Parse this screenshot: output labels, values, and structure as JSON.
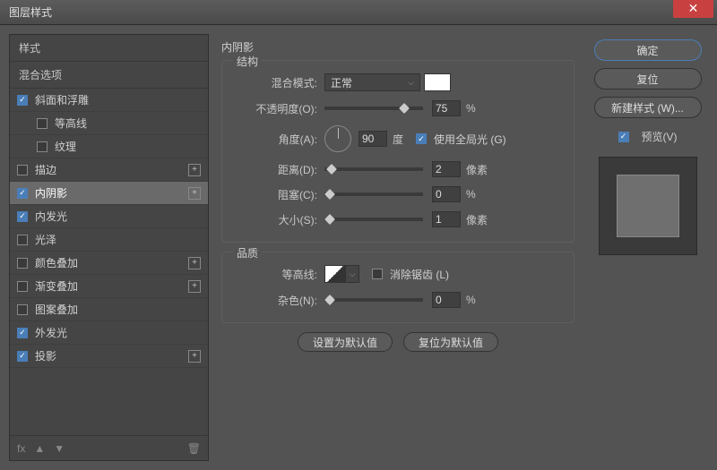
{
  "title": "图层样式",
  "sidebar": {
    "header_styles": "样式",
    "header_blend": "混合选项",
    "items": [
      {
        "label": "斜面和浮雕",
        "checked": true,
        "indent": false,
        "plus": false
      },
      {
        "label": "等高线",
        "checked": false,
        "indent": true,
        "plus": false
      },
      {
        "label": "纹理",
        "checked": false,
        "indent": true,
        "plus": false
      },
      {
        "label": "描边",
        "checked": false,
        "indent": false,
        "plus": true
      },
      {
        "label": "内阴影",
        "checked": true,
        "indent": false,
        "plus": true,
        "selected": true
      },
      {
        "label": "内发光",
        "checked": true,
        "indent": false,
        "plus": false
      },
      {
        "label": "光泽",
        "checked": false,
        "indent": false,
        "plus": false
      },
      {
        "label": "颜色叠加",
        "checked": false,
        "indent": false,
        "plus": true
      },
      {
        "label": "渐变叠加",
        "checked": false,
        "indent": false,
        "plus": true
      },
      {
        "label": "图案叠加",
        "checked": false,
        "indent": false,
        "plus": false
      },
      {
        "label": "外发光",
        "checked": true,
        "indent": false,
        "plus": false
      },
      {
        "label": "投影",
        "checked": true,
        "indent": false,
        "plus": true
      }
    ],
    "fx_label": "fx"
  },
  "center": {
    "title": "内阴影",
    "structure": {
      "legend": "结构",
      "blend_label": "混合模式:",
      "blend_value": "正常",
      "opacity_label": "不透明度(O):",
      "opacity_value": "75",
      "opacity_unit": "%",
      "angle_label": "角度(A):",
      "angle_value": "90",
      "angle_unit": "度",
      "global_light": "使用全局光 (G)",
      "distance_label": "距离(D):",
      "distance_value": "2",
      "distance_unit": "像素",
      "choke_label": "阻塞(C):",
      "choke_value": "0",
      "choke_unit": "%",
      "size_label": "大小(S):",
      "size_value": "1",
      "size_unit": "像素"
    },
    "quality": {
      "legend": "品质",
      "contour_label": "等高线:",
      "antialias": "消除锯齿 (L)",
      "noise_label": "杂色(N):",
      "noise_value": "0",
      "noise_unit": "%"
    },
    "btn_default": "设置为默认值",
    "btn_reset": "复位为默认值"
  },
  "right": {
    "ok": "确定",
    "cancel": "复位",
    "new_style": "新建样式 (W)...",
    "preview": "预览(V)"
  }
}
